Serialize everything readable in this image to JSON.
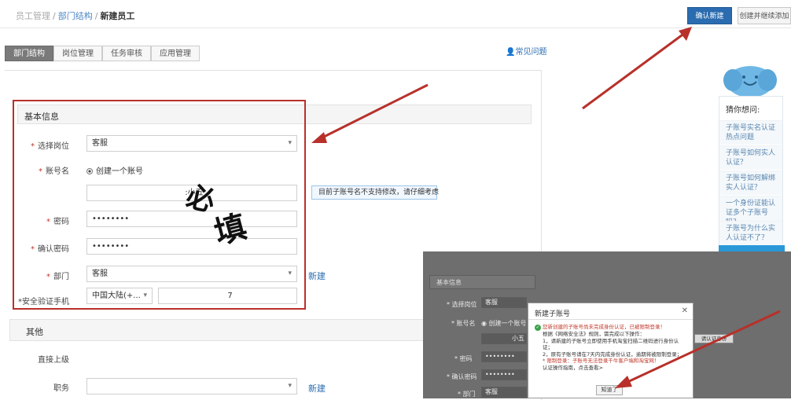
{
  "breadcrumb": {
    "item1": "员工管理",
    "sep": "/",
    "item2": "部门结构",
    "current": "新建员工"
  },
  "toolbar": {
    "confirm": "确认新建",
    "create_continue": "创建并继续添加"
  },
  "tabs": [
    {
      "label": "部门结构"
    },
    {
      "label": "岗位管理"
    },
    {
      "label": "任务审核"
    },
    {
      "label": "应用管理"
    }
  ],
  "faq": {
    "label": "常见问题"
  },
  "basic": {
    "title": "基本信息",
    "position_label": "选择岗位",
    "position_value": "客服",
    "account_label": "账号名",
    "radio_label": "创建一个账号",
    "account_value": ":小五",
    "account_hint": "目前子账号名不支持修改，请仔细考虑",
    "password_label": "密码",
    "password_value": "••••••••",
    "confirm_label": "确认密码",
    "confirm_value": "••••••••",
    "dept_label": "部门",
    "dept_value": "客服",
    "dept_new": "新建",
    "phone_label": "*安全验证手机",
    "phone_region": "中国大陆(+...",
    "phone_value": "7"
  },
  "other": {
    "title": "其他",
    "superior_label": "直接上级",
    "duty_label": "职务",
    "duty_new": "新建"
  },
  "stamp": {
    "text": "必填"
  },
  "sidebar": {
    "heading": "猜你想问:",
    "items": [
      "子账号实名认证热点问题",
      "子账号如何实人认证？",
      "子账号如何解绑实人认证？",
      "一个身份证能认证多个子账号吗？",
      "子账号为什么实人认证不了？"
    ]
  },
  "screenshot": {
    "section": "基本信息",
    "pos_label": "* 选择岗位",
    "pos_value": "客服",
    "acct_label": "* 账号名",
    "acct_radio": "◉ 创建一个账号",
    "acct_value": "小五",
    "pwd_label": "* 密码",
    "pwd_value": "••••••••",
    "cpwd_label": "* 确认密码",
    "cpwd_value": "••••••••",
    "dept_label": "* 部门",
    "dept_value": "客服",
    "side_button": "请认证身份"
  },
  "dialog": {
    "title": "新建子账号",
    "close": "✕",
    "warn": "您新创建的子账号尚未完成身份认证，已被限制登录！",
    "line1": "根据《网络安全法》规则，需完成以下操作：",
    "line2": "1，请新建的子账号立即使用手机淘宝扫描二维码进行身份认证；",
    "line3": "2，原有子账号请在7天内完成身份认证，逾期将被限制登录；",
    "line4": "* 限制登录：子账号无法登录千牛客户端和淘宝网！",
    "line5": "认证操作指南，点击查看>",
    "ok": "知道了"
  }
}
